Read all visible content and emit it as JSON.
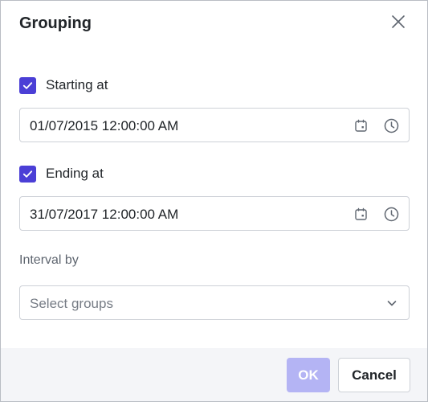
{
  "dialog": {
    "title": "Grouping"
  },
  "start": {
    "label": "Starting at",
    "checked": true,
    "value": "01/07/2015 12:00:00 AM"
  },
  "end": {
    "label": "Ending at",
    "checked": true,
    "value": "31/07/2017 12:00:00 AM"
  },
  "interval": {
    "label": "Interval by",
    "placeholder": "Select groups"
  },
  "footer": {
    "ok_label": "OK",
    "cancel_label": "Cancel"
  },
  "icons": {
    "close": "close-icon",
    "checkbox": "check-icon",
    "date": "calendar-icon",
    "time": "clock-icon",
    "dropdown": "chevron-down-icon"
  },
  "colors": {
    "accent": "#4b3fd6",
    "ok_disabled": "#b4b4f4",
    "footer_bg": "#f4f5f8",
    "border": "#cdd1d7"
  }
}
